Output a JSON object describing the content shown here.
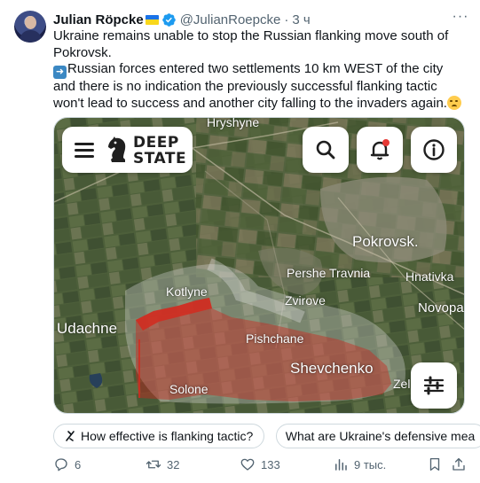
{
  "author": {
    "name": "Julian Röpcke",
    "handle": "@JulianRoepcke",
    "separator": "·",
    "time": "3 ч"
  },
  "tweet": {
    "paragraph1": "Ukraine remains unable to stop the Russian flanking move south of Pokrovsk.",
    "arrow_emoji": "➡️",
    "paragraph2": "Russian forces entered two settlements 10 km WEST of the city and there is no indication the previously successful flanking tactic won't lead to success and another city falling to the invaders again.",
    "end_emoji": "😟"
  },
  "map": {
    "brand_line1": "DEEP",
    "brand_line2": "STATE",
    "labels": {
      "hryshyne": "Hryshyne",
      "pokrovsk": "Pokrovsk.",
      "pershe_travnia": "Pershe Travnia",
      "hnativka": "Hnativka",
      "kotlyne": "Kotlyne",
      "zvirove": "Zvirove",
      "novopa": "Novopa",
      "udachne": "Udachne",
      "pishchane": "Pishchane",
      "shevchenko": "Shevchenko",
      "solone": "Solone",
      "zel": "Zel"
    },
    "occupied_color": "#c9281f",
    "contested_color": "#d9d9d9"
  },
  "chips": [
    "How effective is flanking tactic?",
    "What are Ukraine's defensive mea"
  ],
  "actions": {
    "replies": "6",
    "reposts": "32",
    "likes": "133",
    "views": "9 тыс."
  }
}
